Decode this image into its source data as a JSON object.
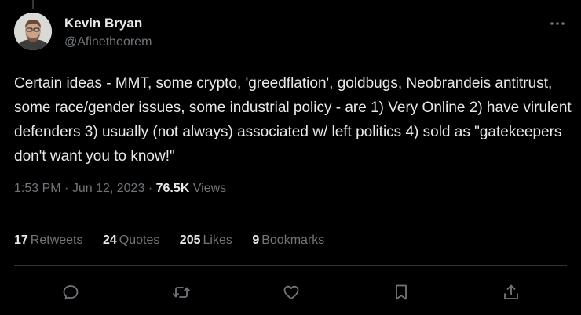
{
  "author": {
    "name": "Kevin Bryan",
    "handle": "@Afinetheorem"
  },
  "tweet": {
    "text": "Certain ideas - MMT, some crypto, 'greedflation', goldbugs, Neobrandeis antitrust, some race/gender issues, some industrial policy - are 1) Very Online 2) have virulent defenders 3) usually (not always) associated w/ left politics 4) sold as \"gatekeepers don't want you to know!\"",
    "time": "1:53 PM",
    "date": "Jun 12, 2023",
    "separator": "·",
    "views_count": "76.5K",
    "views_label": "Views"
  },
  "stats": [
    {
      "count": "17",
      "label": "Retweets"
    },
    {
      "count": "24",
      "label": "Quotes"
    },
    {
      "count": "205",
      "label": "Likes"
    },
    {
      "count": "9",
      "label": "Bookmarks"
    }
  ],
  "icons": {
    "more": "more-horizontal-icon",
    "reply": "reply-icon",
    "retweet": "retweet-icon",
    "like": "heart-icon",
    "bookmark": "bookmark-icon",
    "share": "share-icon"
  },
  "colors": {
    "background": "#000000",
    "text": "#e7e9ea",
    "secondary": "#71767b",
    "divider": "#2f3336"
  }
}
